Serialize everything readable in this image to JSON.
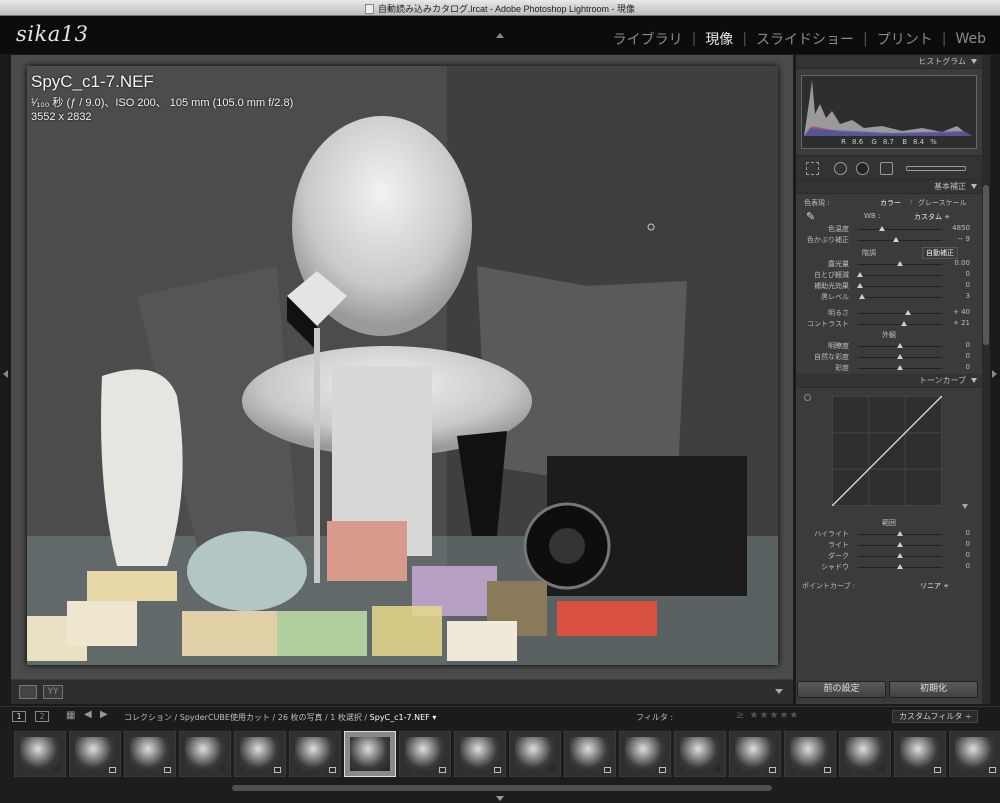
{
  "window": {
    "title": "自動読み込みカタログ.lrcat - Adobe Photoshop Lightroom - 現像"
  },
  "identity": {
    "logo": "sika13"
  },
  "modules": [
    {
      "label": "ライブラリ",
      "active": false
    },
    {
      "label": "現像",
      "active": true
    },
    {
      "label": "スライドショー",
      "active": false
    },
    {
      "label": "プリント",
      "active": false
    },
    {
      "label": "Web",
      "active": false
    }
  ],
  "photo": {
    "filename": "SpyC_c1-7.NEF",
    "exposure": "¹⁄₁₀₀ 秒 (ƒ / 9.0)、ISO 200、 105 mm (105.0 mm f/2.8)",
    "dimensions": "3552 x 2832"
  },
  "histogram": {
    "header": "ヒストグラム",
    "r_label": "R",
    "r": "8.6",
    "g_label": "G",
    "g": "8.7",
    "b_label": "B",
    "b": "8.4",
    "unit": "%"
  },
  "basic": {
    "header": "基本補正",
    "treatment_label": "色表現 :",
    "color_btn": "カラー",
    "gray_btn": "グレースケール",
    "wb_label": "WB :",
    "wb_value": "カスタム ÷",
    "temp": {
      "label": "色温度",
      "value": "4850",
      "pos": 0.28
    },
    "tint": {
      "label": "色かぶり補正",
      "value": "− 9",
      "pos": 0.45
    },
    "tone_label": "階調",
    "auto_btn": "自動補正",
    "exposure": {
      "label": "露光量",
      "value": "0.00",
      "pos": 0.5
    },
    "recovery": {
      "label": "白とび軽減",
      "value": "0",
      "pos": 0.02
    },
    "fill": {
      "label": "補助光効果",
      "value": "0",
      "pos": 0.02
    },
    "blacks": {
      "label": "黒レベル",
      "value": "3",
      "pos": 0.05
    },
    "brightness": {
      "label": "明るさ",
      "value": "+ 40",
      "pos": 0.6
    },
    "contrast": {
      "label": "コントラスト",
      "value": "+ 21",
      "pos": 0.55
    },
    "presence_label": "外観",
    "clarity": {
      "label": "明瞭度",
      "value": "0",
      "pos": 0.5
    },
    "vibrance": {
      "label": "自然な彩度",
      "value": "0",
      "pos": 0.5
    },
    "saturation": {
      "label": "彩度",
      "value": "0",
      "pos": 0.5
    }
  },
  "tone_curve": {
    "header": "トーンカーブ",
    "region_label": "範囲",
    "highlights": {
      "label": "ハイライト",
      "value": "0",
      "pos": 0.5
    },
    "lights": {
      "label": "ライト",
      "value": "0",
      "pos": 0.5
    },
    "darks": {
      "label": "ダーク",
      "value": "0",
      "pos": 0.5
    },
    "shadows": {
      "label": "シャドウ",
      "value": "0",
      "pos": 0.5
    },
    "point_curve_label": "ポイントカーブ :",
    "point_curve_value": "リニア ÷"
  },
  "buttons": {
    "previous": "前の設定",
    "reset": "初期化"
  },
  "filmstrip": {
    "page1": "1",
    "page2": "2",
    "breadcrumb_prefix": "コレクション / SpyderCUBE使用カット / 26 枚の写真 / 1 枚選択 /",
    "breadcrumb_file": "SpyC_c1-7.NEF ▾",
    "filter_label": "フィルタ :",
    "stars": "≥ ★★★★★",
    "custom_filter": "カスタムフィルタ ÷",
    "thumbnail_count": 18,
    "selected_index": 6
  },
  "colors": {
    "accent": "#e9e9e9",
    "panel": "#3b3b3b",
    "background": "#1a1a1a"
  }
}
